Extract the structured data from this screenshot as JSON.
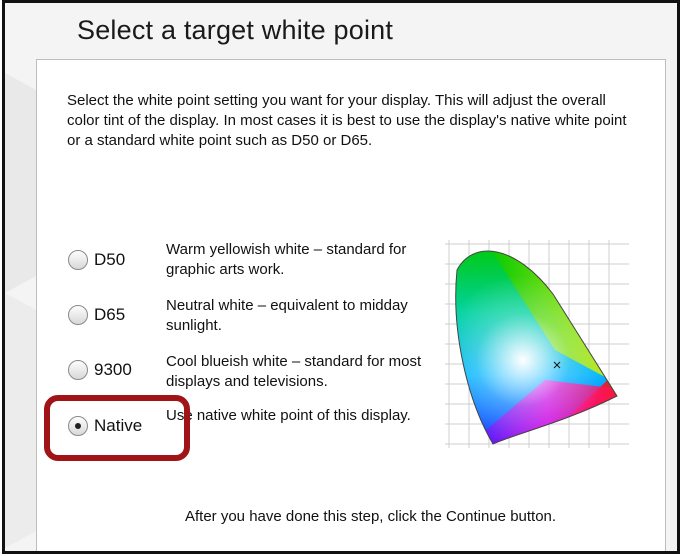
{
  "title": "Select a target white point",
  "intro": "Select the white point setting you want for your display.  This will adjust the overall color tint of the display.  In most cases it is best to use the display's native white point or a standard white point such as D50 or D65.",
  "options": [
    {
      "label": "D50",
      "description": "Warm yellowish white – standard for graphic arts work.",
      "selected": false
    },
    {
      "label": "D65",
      "description": "Neutral white – equivalent to midday sunlight.",
      "selected": false
    },
    {
      "label": "9300",
      "description": "Cool blueish white – standard for most displays and televisions.",
      "selected": false
    },
    {
      "label": "Native",
      "description": "Use native white point of this display.",
      "selected": true
    }
  ],
  "highlight_color": "#a01418",
  "footer": "After you have done this step, click the Continue button.",
  "icons": {
    "chromaticity": "cie-chromaticity-diagram-icon",
    "whitepoint": "white-point-marker-icon"
  }
}
